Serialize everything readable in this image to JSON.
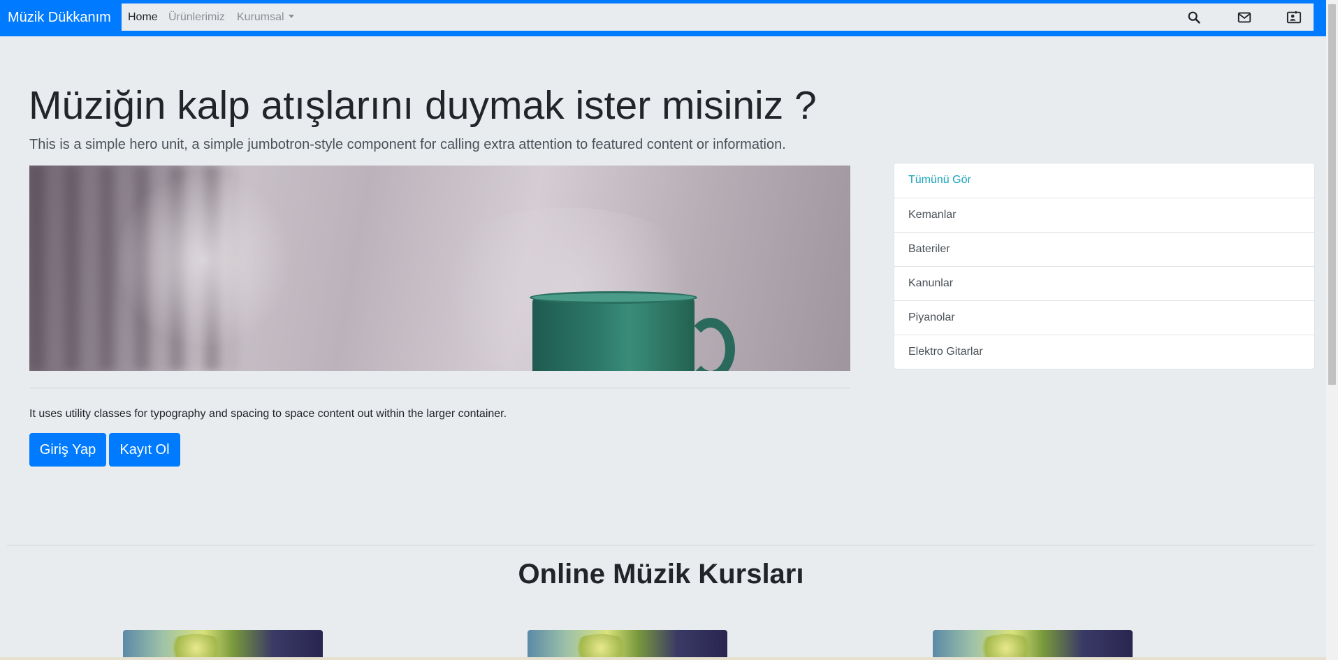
{
  "navbar": {
    "brand": "Müzik Dükkanım",
    "links": [
      {
        "label": "Home"
      },
      {
        "label": "Ürünlerimiz"
      },
      {
        "label": "Kurumsal"
      }
    ],
    "icons": [
      "search-icon",
      "mail-icon",
      "contact-icon"
    ]
  },
  "hero": {
    "title": "Müziğin kalp atışlarını duymak ister misiniz ?",
    "lead": "This is a simple hero unit, a simple jumbotron-style component for calling extra attention to featured content or information.",
    "body": "It uses utility classes for typography and spacing to space content out within the larger container.",
    "buttons": {
      "login": "Giriş Yap",
      "register": "Kayıt Ol"
    }
  },
  "categories": [
    "Tümünü Gör",
    "Kemanlar",
    "Bateriler",
    "Kanunlar",
    "Piyanolar",
    "Elektro Gitarlar"
  ],
  "courses": {
    "title": "Online Müzik Kursları"
  },
  "colors": {
    "primary": "#007bff",
    "background": "#e9ecef",
    "active_link": "#17a2b8"
  }
}
